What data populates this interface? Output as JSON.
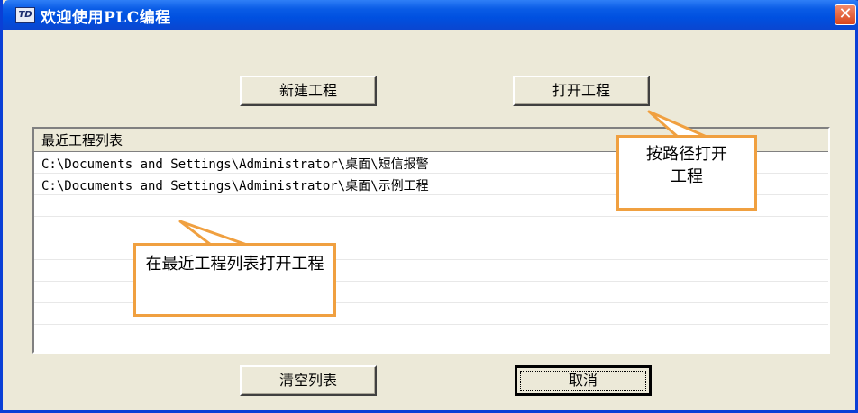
{
  "window": {
    "title": "欢迎使用PLC编程",
    "app_icon_text": "TD",
    "close_glyph": "✕"
  },
  "buttons": {
    "new_project": "新建工程",
    "open_project": "打开工程",
    "clear_list": "清空列表",
    "cancel": "取消"
  },
  "recent_list": {
    "header": "最近工程列表",
    "items": [
      "C:\\Documents and Settings\\Administrator\\桌面\\短信报警",
      "C:\\Documents and Settings\\Administrator\\桌面\\示例工程"
    ]
  },
  "callouts": {
    "open_by_path": "按路径打开工程",
    "open_from_recent": "在最近工程列表打开工程"
  }
}
